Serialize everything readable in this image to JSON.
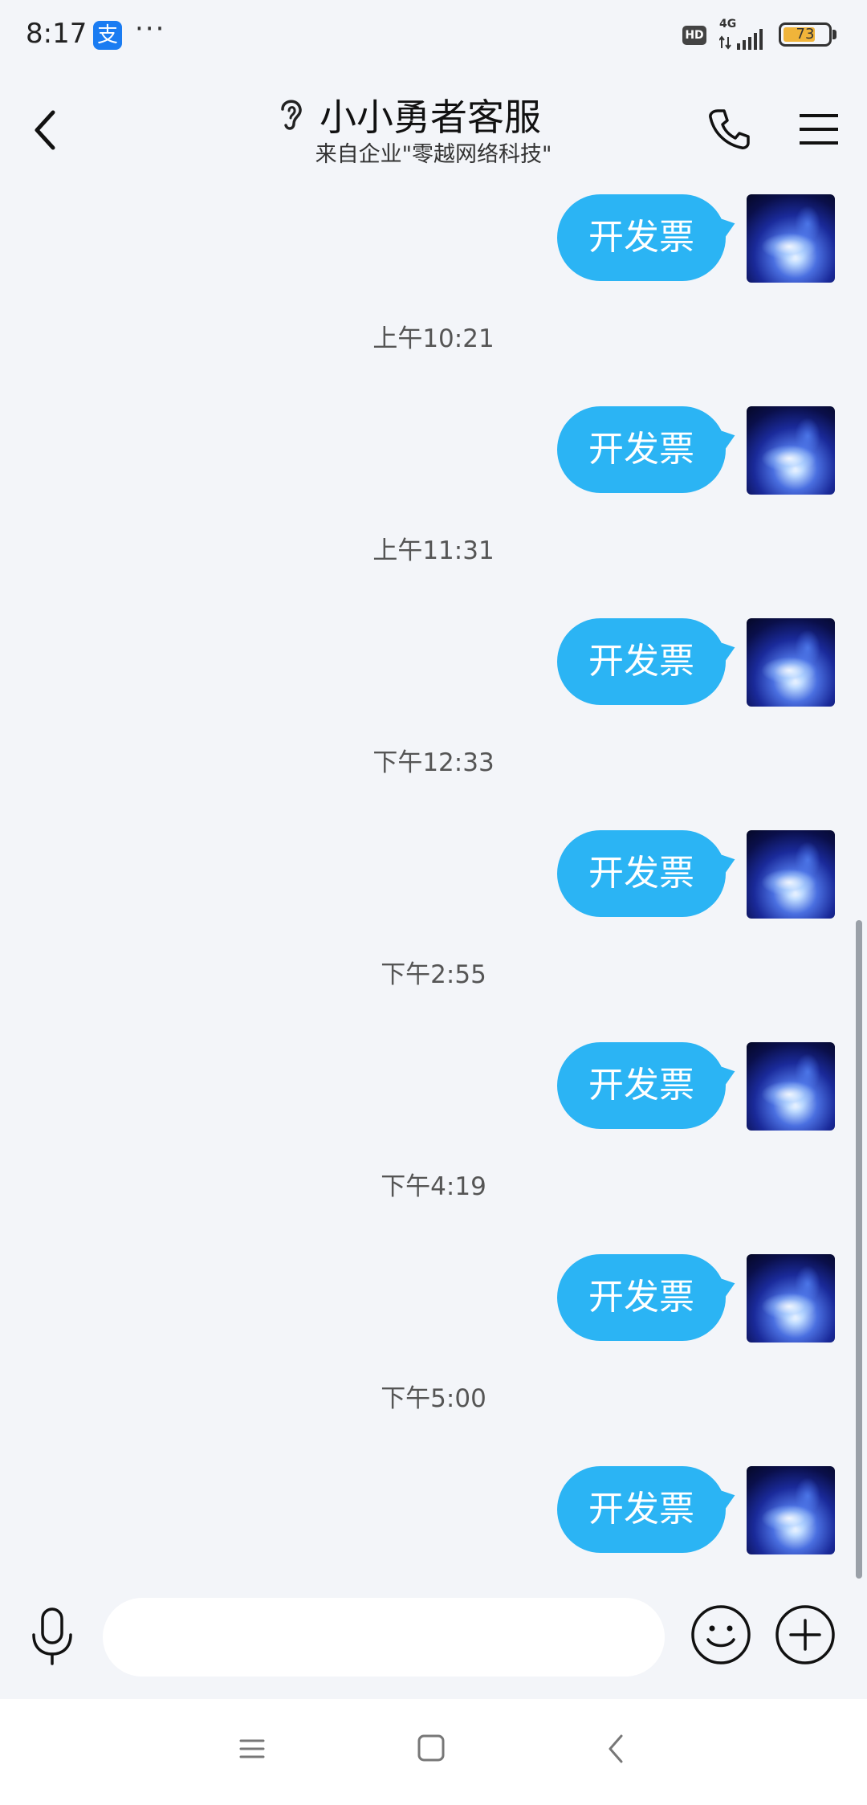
{
  "status_bar": {
    "time": "8:17",
    "alipay_glyph": "支",
    "more_dots": "···",
    "hd_label": "HD",
    "network_label": "4G",
    "battery_percent": "73",
    "battery_level": 0.73
  },
  "header": {
    "title": "小小勇者客服",
    "subtitle": "来自企业\"零越网络科技\"",
    "icons": [
      "back-icon",
      "ear-icon",
      "phone-icon",
      "menu-icon"
    ]
  },
  "messages": [
    {
      "type": "bubble",
      "text": "开发票"
    },
    {
      "type": "time",
      "text": "上午10:21"
    },
    {
      "type": "bubble",
      "text": "开发票"
    },
    {
      "type": "time",
      "text": "上午11:31"
    },
    {
      "type": "bubble",
      "text": "开发票"
    },
    {
      "type": "time",
      "text": "下午12:33"
    },
    {
      "type": "bubble",
      "text": "开发票"
    },
    {
      "type": "time",
      "text": "下午2:55"
    },
    {
      "type": "bubble",
      "text": "开发票"
    },
    {
      "type": "time",
      "text": "下午4:19"
    },
    {
      "type": "bubble",
      "text": "开发票"
    },
    {
      "type": "time",
      "text": "下午5:00"
    },
    {
      "type": "bubble",
      "text": "开发票"
    }
  ],
  "input_bar": {
    "placeholder": "",
    "icons": [
      "mic-icon",
      "emoji-icon",
      "plus-icon"
    ]
  },
  "nav_bar": {
    "icons": [
      "recent-apps-icon",
      "home-icon",
      "back-icon"
    ]
  },
  "colors": {
    "background": "#f3f5f9",
    "bubble": "#2bb4f4",
    "bubble_text": "#ffffff",
    "timestamp": "#555555"
  }
}
